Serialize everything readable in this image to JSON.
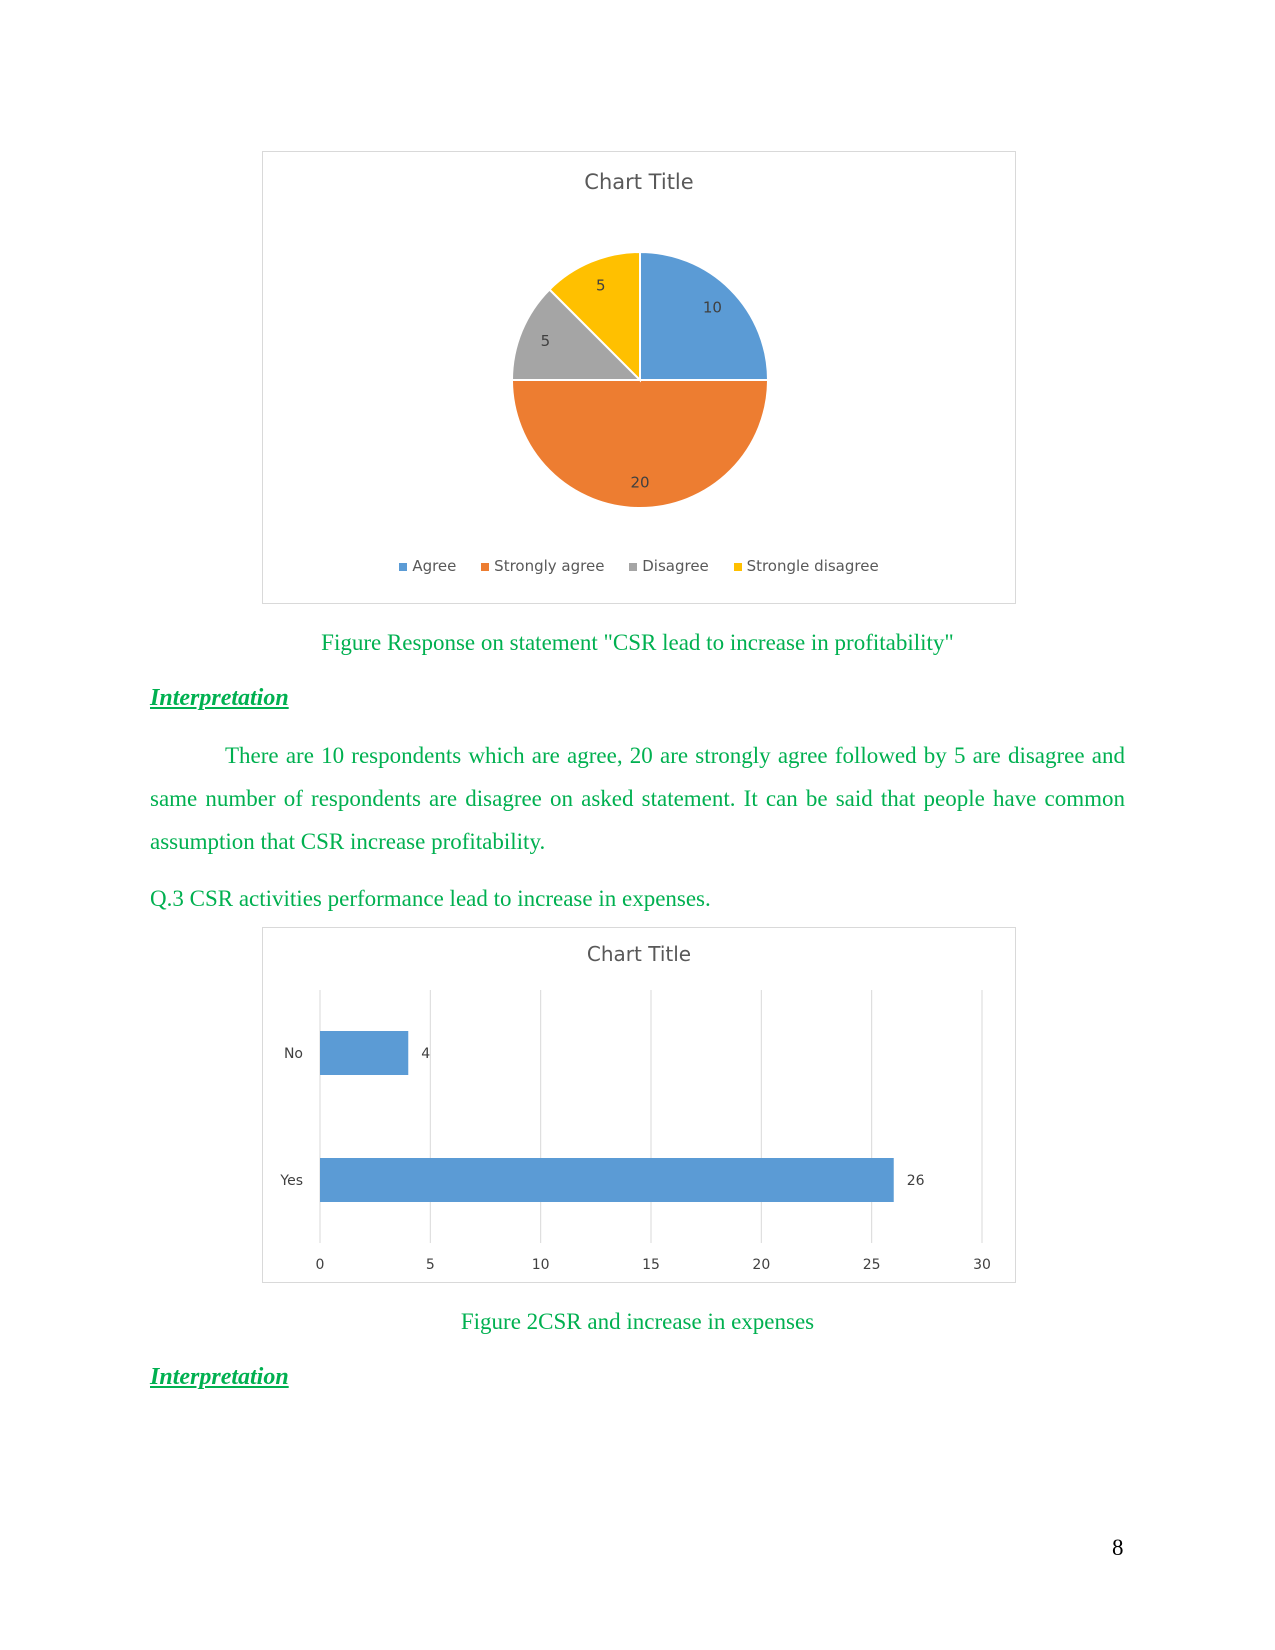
{
  "chart_data": [
    {
      "type": "pie",
      "title": "Chart Title",
      "categories": [
        "Agree",
        "Strongly agree",
        "Disagree",
        "Strongle disagree"
      ],
      "values": [
        10,
        20,
        5,
        5
      ],
      "colors": [
        "#5b9bd5",
        "#ed7d31",
        "#a5a5a5",
        "#ffc000"
      ],
      "legend": "bottom"
    },
    {
      "type": "bar",
      "orientation": "horizontal",
      "title": "Chart Title",
      "categories": [
        "No",
        "Yes"
      ],
      "values": [
        4,
        26
      ],
      "xlim": [
        0,
        30
      ],
      "xticks": [
        "0",
        "5",
        "10",
        "15",
        "20",
        "25",
        "30"
      ],
      "color": "#5b9bd5",
      "grid": true
    }
  ],
  "doc": {
    "caption1": "Figure Response on statement \"CSR lead to increase in profitability\"",
    "heading1": "Interpretation",
    "paragraph1": "There are 10 respondents which are agree, 20 are strongly agree followed by 5 are disagree and same number of respondents are disagree on asked statement. It can be said that people have common assumption that CSR increase profitability.",
    "question3": "Q.3 CSR activities performance lead to increase in expenses.",
    "caption2": "Figure 2CSR and increase in expenses",
    "heading2": "Interpretation",
    "page_number": "8",
    "text_color": "#00b050"
  }
}
